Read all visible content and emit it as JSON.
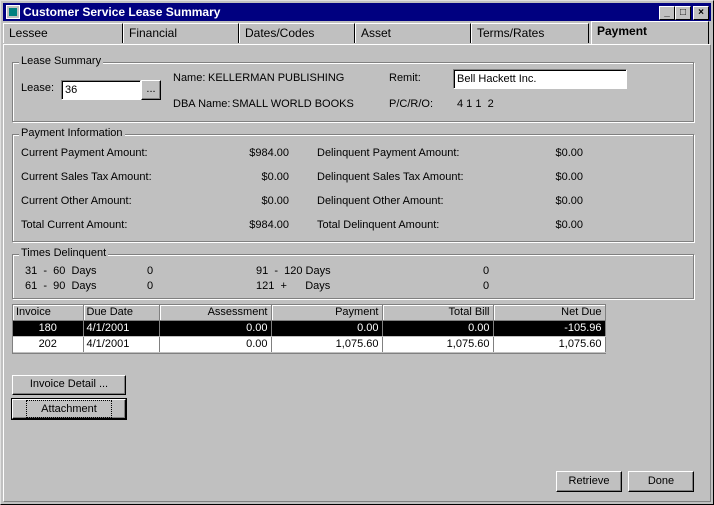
{
  "window": {
    "title": "Customer Service Lease Summary",
    "controls": {
      "minimize": "_",
      "maximize": "□",
      "close": "×"
    }
  },
  "tabs": [
    {
      "label": "Lessee"
    },
    {
      "label": "Financial"
    },
    {
      "label": "Dates/Codes"
    },
    {
      "label": "Asset"
    },
    {
      "label": "Terms/Rates"
    },
    {
      "label": "Payment",
      "active": true
    }
  ],
  "lease_summary": {
    "title": "Lease Summary",
    "lease_label": "Lease:",
    "lease_value": "36",
    "browse_label": "...",
    "name_label": "Name:",
    "name_value": "KELLERMAN PUBLISHING",
    "dba_label": "DBA Name:",
    "dba_value": "SMALL WORLD BOOKS",
    "remit_label": "Remit:",
    "remit_value": "Bell Hackett Inc.",
    "pcro_label": "P/C/R/O:",
    "pcro_value": "4 1 1  2"
  },
  "payment_info": {
    "title": "Payment Information",
    "current_payment_label": "Current Payment Amount:",
    "current_payment_value": "$984.00",
    "current_sales_tax_label": "Current Sales Tax Amount:",
    "current_sales_tax_value": "$0.00",
    "current_other_label": "Current Other Amount:",
    "current_other_value": "$0.00",
    "total_current_label": "Total Current Amount:",
    "total_current_value": "$984.00",
    "delinquent_payment_label": "Delinquent Payment Amount:",
    "delinquent_payment_value": "$0.00",
    "delinquent_sales_tax_label": "Delinquent Sales Tax Amount:",
    "delinquent_sales_tax_value": "$0.00",
    "delinquent_other_label": "Delinquent Other Amount:",
    "delinquent_other_value": "$0.00",
    "total_delinquent_label": "Total Delinquent Amount:",
    "total_delinquent_value": "$0.00"
  },
  "times_delinquent": {
    "title": "Times Delinquent",
    "r31_60_label": "31  -  60  Days",
    "r31_60_value": "0",
    "r61_90_label": "61  -  90  Days",
    "r61_90_value": "0",
    "r91_120_label": "91  -  120 Days",
    "r91_120_value": "0",
    "r121_label": "121  +      Days",
    "r121_value": "0"
  },
  "invoice_grid": {
    "headers": {
      "invoice": "Invoice",
      "due_date": "Due Date",
      "assessment": "Assessment",
      "payment": "Payment",
      "total_bill": "Total Bill",
      "net_due": "Net Due"
    },
    "rows": [
      {
        "invoice": "180",
        "due_date": "4/1/2001",
        "assessment": "0.00",
        "payment": "0.00",
        "total_bill": "0.00",
        "net_due": "-105.96"
      },
      {
        "invoice": "202",
        "due_date": "4/1/2001",
        "assessment": "0.00",
        "payment": "1,075.60",
        "total_bill": "1,075.60",
        "net_due": "1,075.60"
      }
    ]
  },
  "buttons": {
    "invoice_detail": "Invoice Detail ...",
    "attachment": "Attachment",
    "retrieve": "Retrieve",
    "done": "Done"
  }
}
